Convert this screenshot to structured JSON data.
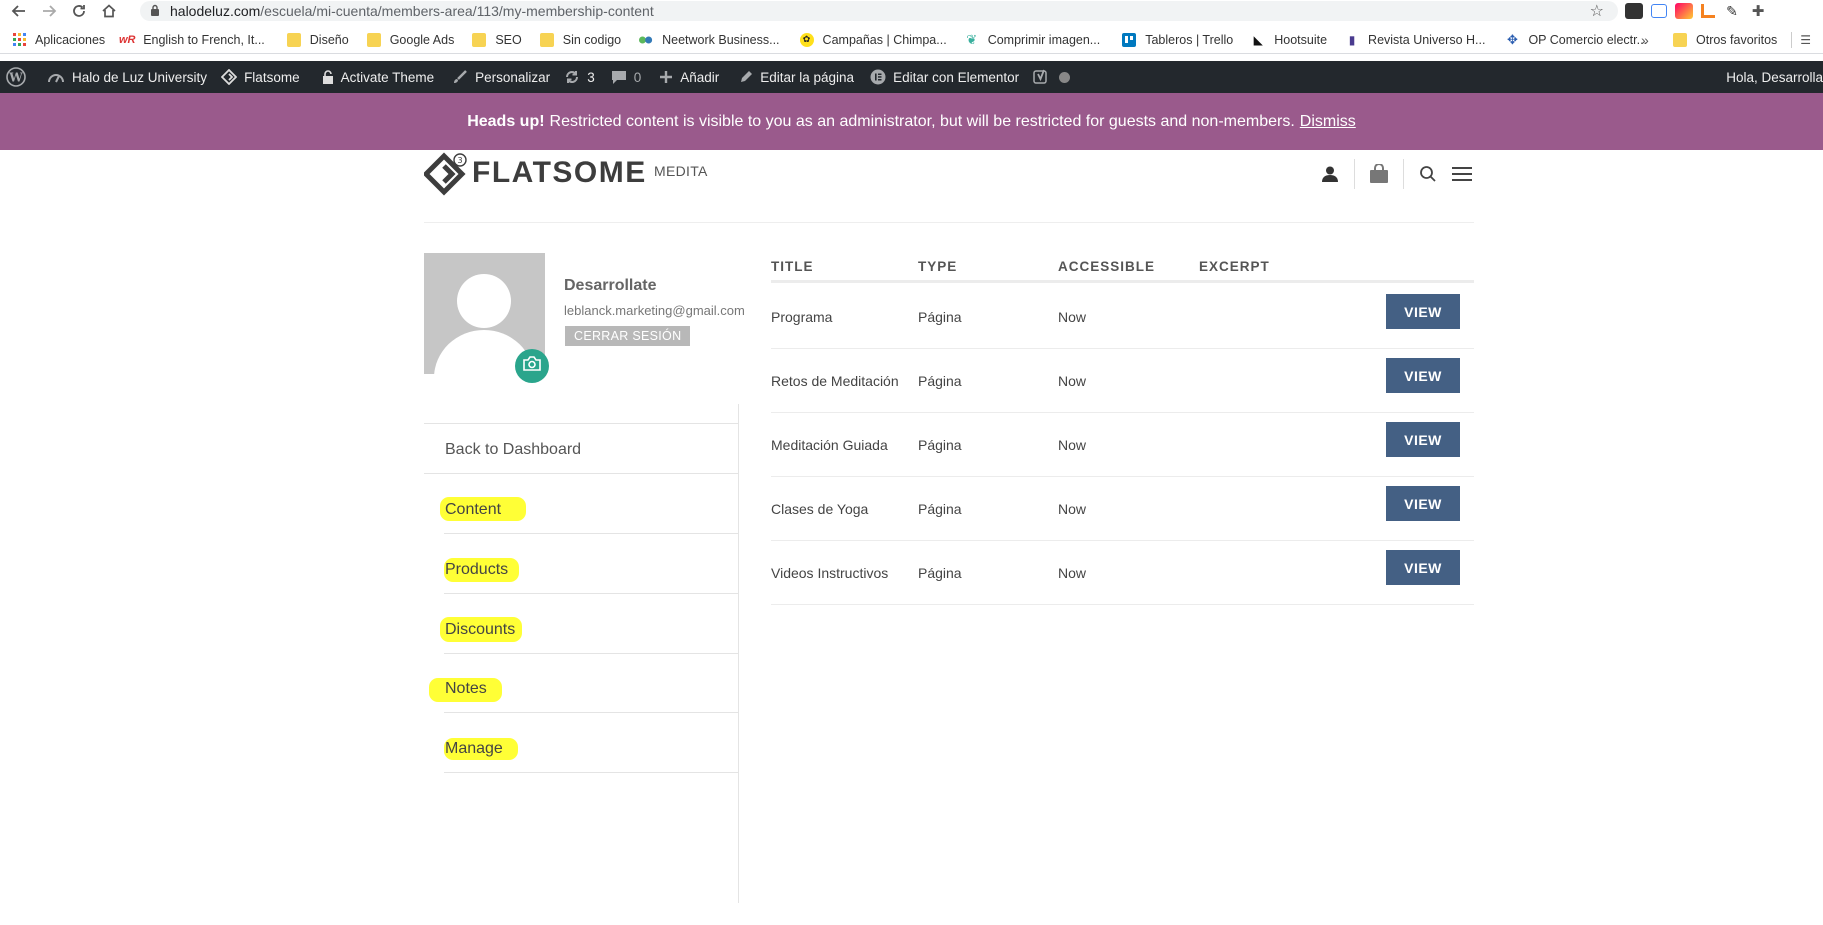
{
  "browser": {
    "url_host": "halodeluz.com",
    "url_path": "/escuela/mi-cuenta/members-area/113/my-membership-content",
    "bookmarks": [
      {
        "label": "Aplicaciones",
        "icon": "apps-grid-icon"
      },
      {
        "label": "English to French, It...",
        "icon": "wr-icon"
      },
      {
        "label": "Diseño",
        "icon": "folder-icon"
      },
      {
        "label": "Google Ads",
        "icon": "folder-icon"
      },
      {
        "label": "SEO",
        "icon": "folder-icon"
      },
      {
        "label": "Sin codigo",
        "icon": "folder-icon"
      },
      {
        "label": "Neetwork Business...",
        "icon": "neetwork-icon"
      },
      {
        "label": "Campañas | Chimpa...",
        "icon": "mailchimp-icon"
      },
      {
        "label": "Comprimir imagen...",
        "icon": "leaf-icon"
      },
      {
        "label": "Tableros | Trello",
        "icon": "trello-icon"
      },
      {
        "label": "Hootsuite",
        "icon": "hootsuite-icon"
      },
      {
        "label": "Revista Universo H...",
        "icon": "bookmark-page-icon"
      },
      {
        "label": "OP Comercio electr...",
        "icon": "op-icon"
      }
    ],
    "other_bookmarks": "Otros favoritos",
    "colors": {
      "folder": "#f7d353"
    }
  },
  "adminbar": {
    "site": "Halo de Luz University",
    "theme": "Flatsome",
    "activate": "Activate Theme",
    "customize": "Personalizar",
    "updates": "3",
    "comments": "0",
    "add": "Añadir",
    "edit_page": "Editar la página",
    "edit_elementor": "Editar con Elementor",
    "greeting": "Hola, Desarrolla"
  },
  "notice": {
    "bold": "Heads up!",
    "text": "Restricted content is visible to you as an administrator, but will be restricted for guests and non-members.",
    "dismiss": "Dismiss",
    "color": "#9a5a8c"
  },
  "header": {
    "logo_text": "FLATSOME",
    "logo_badge": "3",
    "menu_item": "MEDITA"
  },
  "profile": {
    "name": "Desarrollate",
    "email": "leblanck.marketing@gmail.com",
    "logout": "CERRAR SESIÓN"
  },
  "sidenav": {
    "back": "Back to Dashboard",
    "items": [
      "Content",
      "Products",
      "Discounts",
      "Notes",
      "Manage"
    ],
    "highlight_color": "#ffff36"
  },
  "table": {
    "headers": [
      "TITLE",
      "TYPE",
      "ACCESSIBLE",
      "EXCERPT"
    ],
    "button_label": "VIEW",
    "button_color": "#446084",
    "rows": [
      {
        "title": "Programa",
        "type": "Página",
        "accessible": "Now",
        "excerpt": ""
      },
      {
        "title": "Retos de Meditación",
        "type": "Página",
        "accessible": "Now",
        "excerpt": ""
      },
      {
        "title": "Meditación Guiada",
        "type": "Página",
        "accessible": "Now",
        "excerpt": ""
      },
      {
        "title": "Clases de Yoga",
        "type": "Página",
        "accessible": "Now",
        "excerpt": ""
      },
      {
        "title": "Videos Instructivos",
        "type": "Página",
        "accessible": "Now",
        "excerpt": ""
      }
    ]
  }
}
